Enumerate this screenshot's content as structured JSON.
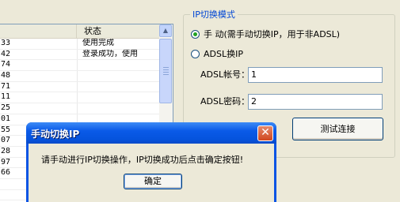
{
  "list": {
    "headers": [
      "",
      "状态"
    ],
    "rows": [
      {
        "num": "33",
        "status": "使用完成"
      },
      {
        "num": "42",
        "status": "登录成功，使用"
      },
      {
        "num": "74",
        "status": ""
      },
      {
        "num": "48",
        "status": ""
      },
      {
        "num": "71",
        "status": ""
      },
      {
        "num": "11",
        "status": ""
      },
      {
        "num": "25",
        "status": ""
      },
      {
        "num": "01",
        "status": ""
      },
      {
        "num": "55",
        "status": ""
      },
      {
        "num": "07",
        "status": ""
      },
      {
        "num": "28",
        "status": ""
      },
      {
        "num": "97",
        "status": ""
      },
      {
        "num": "66",
        "status": ""
      },
      {
        "num": "",
        "status": ""
      },
      {
        "num": "",
        "status": ""
      },
      {
        "num": "",
        "status": ""
      }
    ]
  },
  "ip_group": {
    "title": "IP切换模式",
    "manual_radio": "手 动(需手动切换IP，用于非ADSL)",
    "adsl_radio": "ADSL换IP",
    "account_label": "ADSL帐号：",
    "account_value": "1",
    "password_label": "ADSL密码：",
    "password_value": "2",
    "test_button": "测试连接"
  },
  "dialog": {
    "title": "手动切换IP",
    "message": "请手动进行IP切换操作，IP切换成功后点击确定按钮!",
    "ok_button": "确定",
    "close_glyph": "✕"
  }
}
